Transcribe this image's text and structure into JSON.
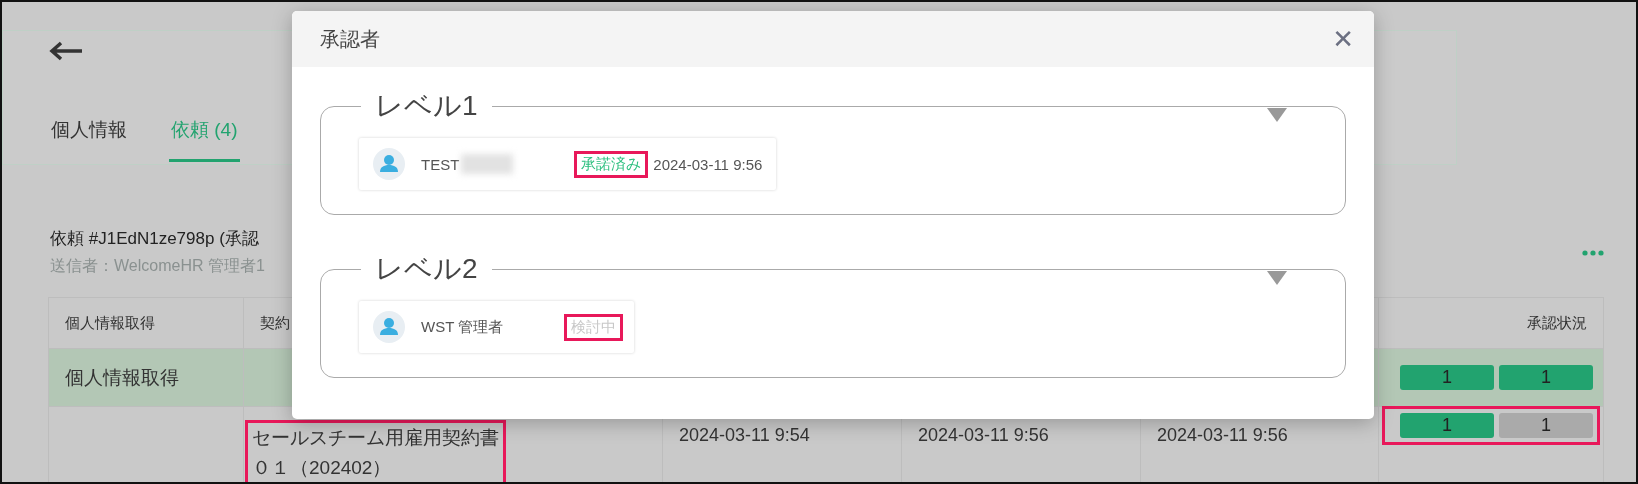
{
  "page": {
    "tabs": [
      {
        "label": "個人情報",
        "selected": false
      },
      {
        "label": "依頼 (4)",
        "selected": true
      }
    ],
    "request": {
      "title": "依頼 #J1EdN1ze798p (承認",
      "sender": "送信者：WelcomeHR 管理者1"
    },
    "table": {
      "columns": [
        {
          "label": "個人情報取得"
        },
        {
          "label": "契約"
        },
        {},
        {},
        {},
        {
          "label": "承認状況"
        }
      ],
      "rows": [
        {
          "kind": "group",
          "label": "個人情報取得",
          "approvals": [
            {
              "label": "1",
              "approved": true
            },
            {
              "label": "1",
              "approved": true
            }
          ],
          "highlighted": false
        },
        {
          "kind": "document",
          "document": "セールスチーム用雇用契約書０１（202402）",
          "document_highlighted": true,
          "dates": [
            "2024-03-11 9:54",
            "2024-03-11 9:56",
            "2024-03-11 9:56"
          ],
          "approvals": [
            {
              "label": "1",
              "approved": true
            },
            {
              "label": "1",
              "approved": false
            }
          ],
          "highlighted": true
        }
      ]
    }
  },
  "modal": {
    "title": "承認者",
    "close": "✕",
    "levels": [
      {
        "label": "レベル1",
        "approvers": [
          {
            "name": "TEST",
            "redacted": true,
            "status": "承諾済み",
            "approved": true,
            "date": "2024-03-11 9:56",
            "highlighted": true
          }
        ]
      },
      {
        "label": "レベル2",
        "approvers": [
          {
            "name": "WST 管理者",
            "redacted": false,
            "status": "検討中",
            "approved": false,
            "highlighted": true
          }
        ]
      }
    ]
  }
}
